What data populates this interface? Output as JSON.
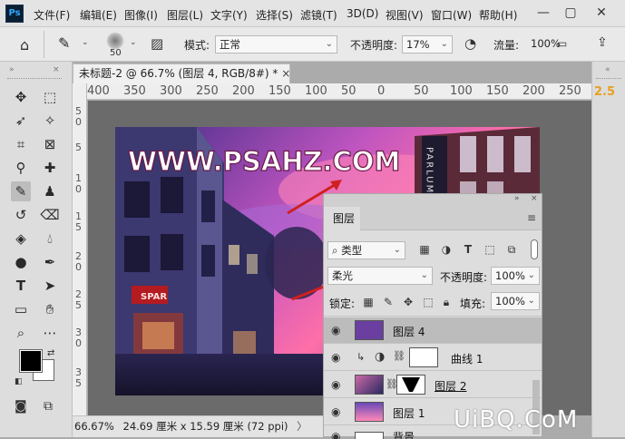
{
  "app": {
    "logo_text": "Ps"
  },
  "menu": [
    "文件(F)",
    "编辑(E)",
    "图像(I)",
    "图层(L)",
    "文字(Y)",
    "选择(S)",
    "滤镜(T)",
    "3D(D)",
    "视图(V)",
    "窗口(W)",
    "帮助(H)"
  ],
  "window_controls": {
    "minimize": "—",
    "restore": "▢",
    "close": "✕"
  },
  "options": {
    "brush_size": "50",
    "mode_label": "模式:",
    "mode_value": "正常",
    "opacity_label": "不透明度:",
    "opacity_value": "17%",
    "flow_label": "流量:",
    "flow_value": "100%"
  },
  "document": {
    "tab_title": "未标题-2 @ 66.7% (图层 4, RGB/8#) *",
    "close": "×",
    "ruler_top": [
      "400",
      "350",
      "300",
      "250",
      "200",
      "150",
      "100",
      "50",
      "0",
      "50",
      "100",
      "150",
      "200",
      "250",
      "300"
    ],
    "ruler_left": [
      "5",
      "0",
      "5",
      "1",
      "0",
      "1",
      "5",
      "2",
      "0",
      "2",
      "5",
      "3",
      "0",
      "3",
      "5"
    ],
    "zoom": "66.67%",
    "size": "24.69 厘米 x 15.59 厘米 (72 ppi)",
    "status_arrow": "〉"
  },
  "photo": {
    "headline": "WWW.PSAHZ.COM",
    "sign_left": "PARLUM",
    "shop_sign": "SPAR"
  },
  "right_strip": {
    "value": "2.5"
  },
  "layers_panel": {
    "tab": "图层",
    "filter_type": "类型",
    "blend_mode": "柔光",
    "opacity_label": "不透明度:",
    "opacity_value": "100%",
    "lock_label": "锁定:",
    "fill_label": "填充:",
    "fill_value": "100%",
    "layers": [
      {
        "name": "图层 4",
        "selected": true,
        "thumb_color": "#6a3fa0"
      },
      {
        "name": "曲线 1",
        "selected": false,
        "adjustment": true
      },
      {
        "name": "图层 2",
        "selected": false,
        "masked": true
      },
      {
        "name": "图层 1",
        "selected": false
      },
      {
        "name": "背景",
        "selected": false
      }
    ]
  },
  "watermark": "UiBQ.CoM",
  "colors": {
    "foreground": "#000000",
    "background": "#ffffff",
    "accent": "#2d6bd1",
    "selected_layer": "#bcbcbc"
  }
}
